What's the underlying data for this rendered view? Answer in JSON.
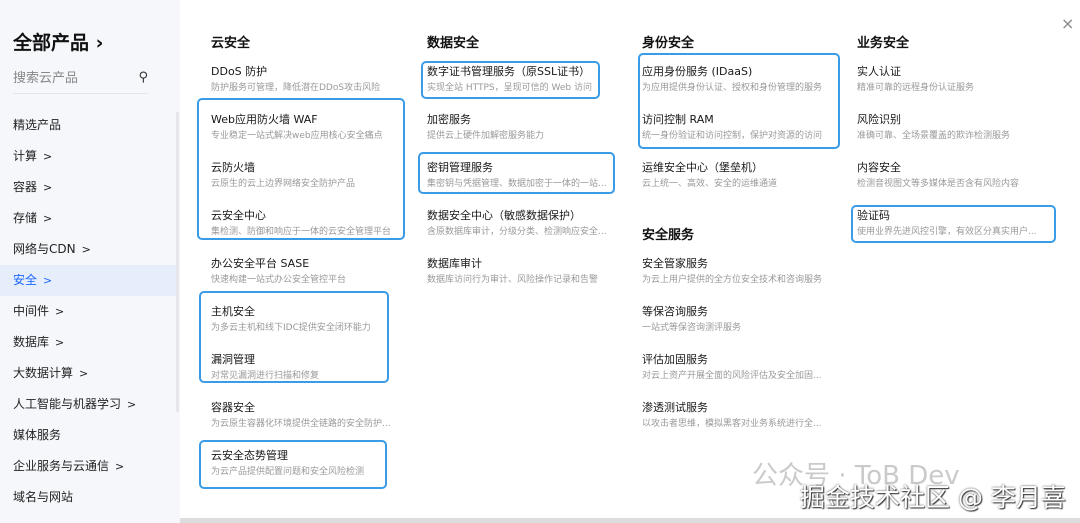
{
  "sidebar": {
    "title": "全部产品",
    "title_chevron": "›",
    "search_placeholder": "搜索云产品",
    "items": [
      {
        "label": "精选产品",
        "chev": ""
      },
      {
        "label": "计算",
        "chev": ">"
      },
      {
        "label": "容器",
        "chev": ">"
      },
      {
        "label": "存储",
        "chev": ">"
      },
      {
        "label": "网络与CDN",
        "chev": ">"
      },
      {
        "label": "安全",
        "chev": ">"
      },
      {
        "label": "中间件",
        "chev": ">"
      },
      {
        "label": "数据库",
        "chev": ">"
      },
      {
        "label": "大数据计算",
        "chev": ">"
      },
      {
        "label": "人工智能与机器学习",
        "chev": ">"
      },
      {
        "label": "媒体服务",
        "chev": ""
      },
      {
        "label": "企业服务与云通信",
        "chev": ">"
      },
      {
        "label": "域名与网站",
        "chev": ""
      }
    ],
    "active_index": 5
  },
  "columns": [
    {
      "heading": "云安全",
      "items": [
        {
          "title": "DDoS 防护",
          "desc": "防护服务可管理，降低潜在DDoS攻击风险"
        },
        {
          "title": "Web应用防火墙 WAF",
          "desc": "专业稳定一站式解决web应用核心安全痛点"
        },
        {
          "title": "云防火墙",
          "desc": "云原生的云上边界网络安全防护产品"
        },
        {
          "title": "云安全中心",
          "desc": "集检测、防御和响应于一体的云安全管理平台"
        },
        {
          "title": "办公安全平台 SASE",
          "desc": "快速构建一站式办公安全管控平台"
        },
        {
          "title": "主机安全",
          "desc": "为多云主机和线下IDC提供安全闭环能力"
        },
        {
          "title": "漏洞管理",
          "desc": "对常见漏洞进行扫描和修复"
        },
        {
          "title": "容器安全",
          "desc": "为云原生容器化环境提供全链路的安全防护..."
        },
        {
          "title": "云安全态势管理",
          "desc": "为云产品提供配置问题和安全风险检测"
        }
      ]
    },
    {
      "heading": "数据安全",
      "items": [
        {
          "title": "数字证书管理服务（原SSL证书）",
          "desc": "实现全站 HTTPS，呈现可信的 Web 访问"
        },
        {
          "title": "加密服务",
          "desc": "提供云上硬件加解密服务能力"
        },
        {
          "title": "密钥管理服务",
          "desc": "集密钥与凭据管理、数据加密于一体的一站..."
        },
        {
          "title": "数据安全中心（敏感数据保护）",
          "desc": "含原数据库审计，分级分类、检测响应安全..."
        },
        {
          "title": "数据库审计",
          "desc": "数据库访问行为审计、风险操作记录和告警"
        }
      ]
    },
    {
      "heading": "身份安全",
      "items": [
        {
          "title": "应用身份服务 (IDaaS)",
          "desc": "为应用提供身份认证、授权和身份管理的服务"
        },
        {
          "title": "访问控制 RAM",
          "desc": "统一身份验证和访问控制，保护对资源的访问"
        },
        {
          "title": "运维安全中心（堡垒机）",
          "desc": "云上统一、高效、安全的运维通道"
        }
      ]
    },
    {
      "heading": "安全服务",
      "items": [
        {
          "title": "安全管家服务",
          "desc": "为云上用户提供的全方位安全技术和咨询服务"
        },
        {
          "title": "等保咨询服务",
          "desc": "一站式等保咨询测评服务"
        },
        {
          "title": "评估加固服务",
          "desc": "对云上资产开展全面的风险评估及安全加固..."
        },
        {
          "title": "渗透测试服务",
          "desc": "以攻击者思维，模拟黑客对业务系统进行全..."
        }
      ]
    },
    {
      "heading": "业务安全",
      "items": [
        {
          "title": "实人认证",
          "desc": "精准可靠的远程身份认证服务"
        },
        {
          "title": "风险识别",
          "desc": "准确可靠、全场景覆盖的欺诈检测服务"
        },
        {
          "title": "内容安全",
          "desc": "检测音视图文等多媒体是否含有风险内容"
        },
        {
          "title": "验证码",
          "desc": "使用业界先进风控引擎，有效区分真实用户..."
        }
      ]
    }
  ],
  "close_icon": "×",
  "watermark": {
    "line1": "公众号 · ToB Dev",
    "line2": "掘金技术社区 @ 李月喜"
  },
  "colors": {
    "highlight": "#3a9be6",
    "active_bg": "#e6eefc",
    "active_text": "#1a66ff"
  }
}
